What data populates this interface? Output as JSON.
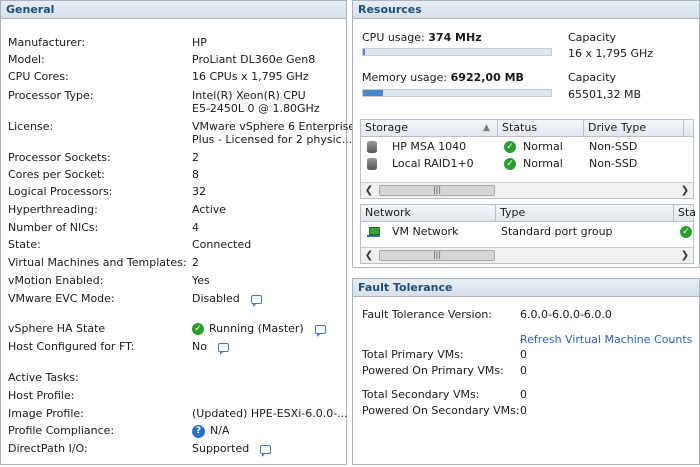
{
  "general": {
    "title": "General",
    "rows": [
      {
        "label": "Manufacturer:",
        "value": "HP"
      },
      {
        "label": "Model:",
        "value": "ProLiant DL360e Gen8"
      },
      {
        "label": "CPU Cores:",
        "value": "16 CPUs x 1,795 GHz"
      },
      {
        "label": "Processor Type:",
        "value_lines": [
          "Intel(R) Xeon(R) CPU",
          "E5-2450L 0 @ 1.80GHz"
        ]
      },
      {
        "label": "License:",
        "value_lines": [
          "VMware vSphere 6 Enterprise",
          "Plus - Licensed for 2 physic..."
        ]
      },
      {
        "label": "Processor Sockets:",
        "value": "2"
      },
      {
        "label": "Cores per Socket:",
        "value": "8"
      },
      {
        "label": "Logical Processors:",
        "value": "32"
      },
      {
        "label": "Hyperthreading:",
        "value": "Active"
      },
      {
        "label": "Number of NICs:",
        "value": "4"
      },
      {
        "label": "State:",
        "value": "Connected"
      },
      {
        "label": "Virtual Machines and Templates:",
        "value": "2"
      },
      {
        "label": "vMotion Enabled:",
        "value": "Yes"
      },
      {
        "label": "VMware EVC Mode:",
        "value": "Disabled"
      },
      {
        "label": "vSphere HA State",
        "value": "Running (Master)"
      },
      {
        "label": "Host Configured for FT:",
        "value": "No"
      },
      {
        "label": "Active Tasks:",
        "value": ""
      },
      {
        "label": "Host Profile:",
        "value": ""
      },
      {
        "label": "Image Profile:",
        "value": "(Updated) HPE-ESXi-6.0.0-..."
      },
      {
        "label": "Profile Compliance:",
        "value": "N/A"
      },
      {
        "label": "DirectPath I/O:",
        "value": "Supported"
      }
    ]
  },
  "resources": {
    "title": "Resources",
    "cpu_label": "CPU usage:",
    "cpu_value": "374 MHz",
    "cpu_fraction": 0.01,
    "capacity_label": "Capacity",
    "cpu_capacity": "16 x 1,795 GHz",
    "mem_label": "Memory usage:",
    "mem_value": "6922,00 MB",
    "mem_fraction": 0.106,
    "mem_capacity": "65501,32 MB",
    "storage_table": {
      "headers": [
        "Storage",
        "Status",
        "Drive Type"
      ],
      "rows": [
        {
          "name": "HP MSA 1040",
          "status": "Normal",
          "drive": "Non-SSD"
        },
        {
          "name": "Local RAID1+0",
          "status": "Normal",
          "drive": "Non-SSD"
        }
      ]
    },
    "network_table": {
      "headers": [
        "Network",
        "Type",
        "Sta"
      ],
      "rows": [
        {
          "name": "VM Network",
          "type": "Standard port group"
        }
      ]
    }
  },
  "fault_tolerance": {
    "title": "Fault Tolerance",
    "version_label": "Fault Tolerance Version:",
    "version_value": "6.0.0-6.0.0-6.0.0",
    "refresh_link": "Refresh Virtual Machine Counts",
    "rows": [
      {
        "label": "Total Primary VMs:",
        "value": "0"
      },
      {
        "label": "Powered On Primary VMs:",
        "value": "0"
      },
      {
        "label": "Total Secondary VMs:",
        "value": "0"
      },
      {
        "label": "Powered On Secondary VMs:",
        "value": "0"
      }
    ]
  },
  "colors": {
    "accent": "#1f4e79",
    "link": "#2a63b8",
    "ok": "#2f9a2f",
    "bar_fill": "#4a86d0"
  },
  "icons": {
    "ok": "check-circle-icon",
    "help": "question-icon",
    "note": "comment-bubble-icon",
    "storage": "datastore-icon",
    "network": "network-icon"
  }
}
